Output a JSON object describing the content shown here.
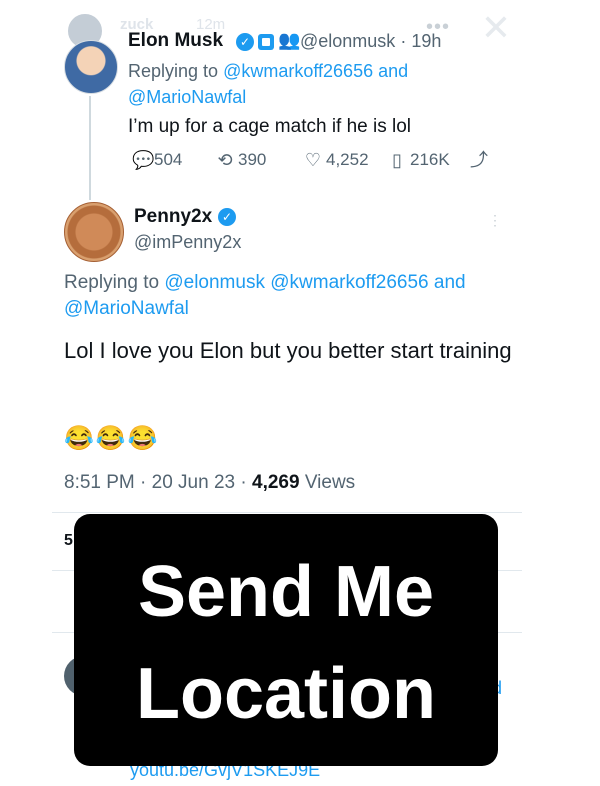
{
  "story": {
    "username": "zuck",
    "time": "12m"
  },
  "tweet": {
    "name": "Elon Musk",
    "handle": "@elonmusk",
    "age": "19h",
    "reply_prefix": "Replying to",
    "reply_to_1": "@kwmarkoff26656",
    "reply_and": "and",
    "reply_to_2": "@MarioNawfal",
    "text": "I’m up for a cage match if he is lol",
    "metrics": {
      "replies": "504",
      "retweets": "390",
      "likes": "4,252",
      "views": "216K"
    }
  },
  "reply": {
    "name": "Penny2x",
    "handle": "@imPenny2x",
    "reply_prefix": "Replying to",
    "reply_to_1": "@elonmusk",
    "reply_to_2": "@kwmarkoff26656",
    "reply_and": "and",
    "reply_to_3": "@MarioNawfal",
    "text": "Lol I love you Elon but you better start training",
    "emojis": "😂😂😂",
    "timestamp": "8:51 PM · 20 Jun 23 · ",
    "views_count": "4,269",
    "views_label": "Views"
  },
  "partial": {
    "number": "5",
    "link": "youtu.be/GvjV1SKEJ9E",
    "letter": "d"
  },
  "overlay": {
    "line1": "Send Me",
    "line2": "Location"
  },
  "colors": {
    "accent": "#1d9bf0",
    "text": "#0f1419",
    "muted": "#536471"
  },
  "icons": {
    "verified": "verified-badge-icon",
    "reply": "reply-icon",
    "retweet": "retweet-icon",
    "like": "heart-icon",
    "views": "views-bar-icon",
    "share": "share-icon",
    "more": "more-dots-icon",
    "close": "close-icon"
  }
}
